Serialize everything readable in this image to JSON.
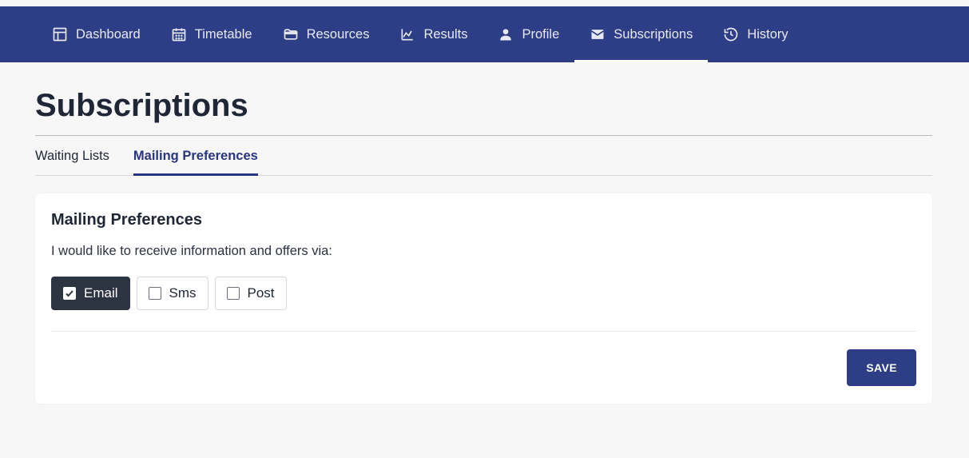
{
  "nav": {
    "items": [
      {
        "label": "Dashboard",
        "icon": "dashboard-icon",
        "active": false
      },
      {
        "label": "Timetable",
        "icon": "calendar-icon",
        "active": false
      },
      {
        "label": "Resources",
        "icon": "folder-icon",
        "active": false
      },
      {
        "label": "Results",
        "icon": "chart-icon",
        "active": false
      },
      {
        "label": "Profile",
        "icon": "person-icon",
        "active": false
      },
      {
        "label": "Subscriptions",
        "icon": "mail-icon",
        "active": true
      },
      {
        "label": "History",
        "icon": "history-icon",
        "active": false
      }
    ]
  },
  "page": {
    "title": "Subscriptions"
  },
  "tabs": [
    {
      "label": "Waiting Lists",
      "active": false
    },
    {
      "label": "Mailing Preferences",
      "active": true
    }
  ],
  "card": {
    "title": "Mailing Preferences",
    "lead": "I would like to receive information and offers via:",
    "options": [
      {
        "label": "Email",
        "checked": true
      },
      {
        "label": "Sms",
        "checked": false
      },
      {
        "label": "Post",
        "checked": false
      }
    ],
    "save_label": "SAVE"
  },
  "colors": {
    "navbar": "#2d3e87",
    "accent": "#27367f",
    "checked_pill": "#2d3441"
  }
}
